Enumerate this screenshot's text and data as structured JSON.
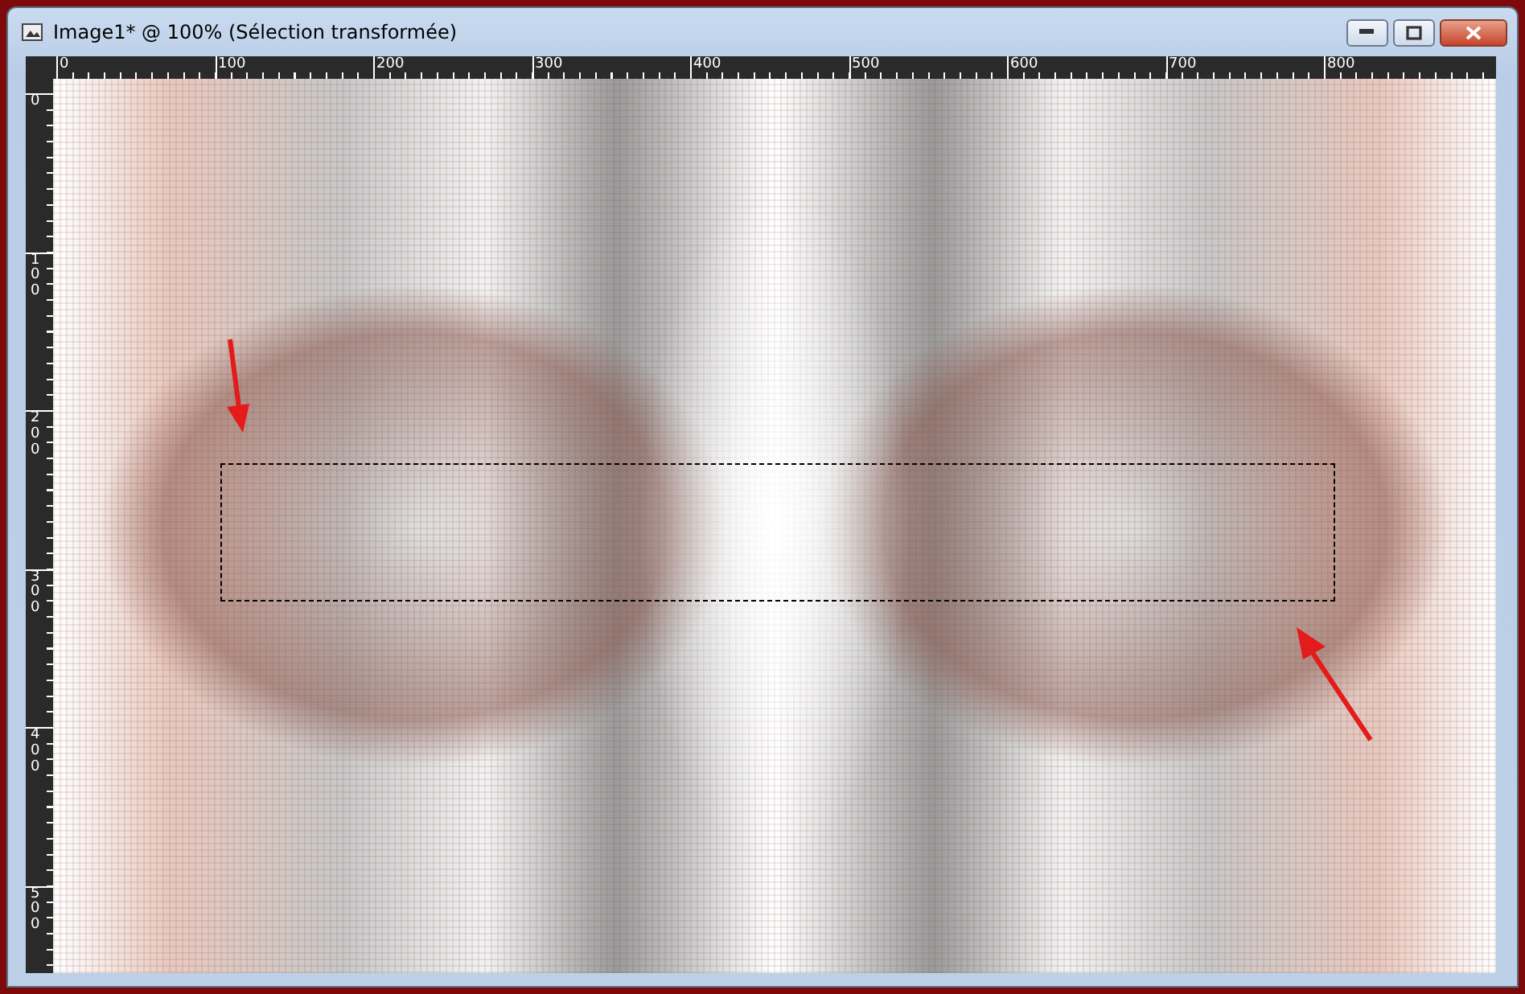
{
  "window": {
    "title": "Image1* @ 100% (Sélection transformée)"
  },
  "ruler_top": {
    "labels": [
      "0",
      "100",
      "200",
      "300",
      "400",
      "500",
      "600",
      "700",
      "800"
    ]
  },
  "ruler_left": {
    "labels": [
      "0",
      "100",
      "200",
      "300",
      "400",
      "500"
    ]
  }
}
